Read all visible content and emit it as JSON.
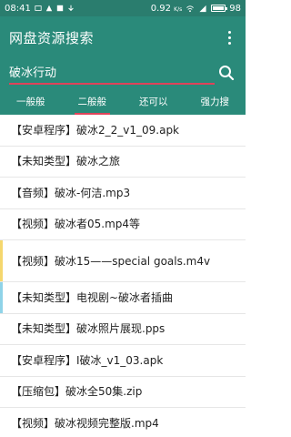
{
  "status_bar": {
    "time": "08:41",
    "left_icons": [
      "message-icon",
      "warning-icon",
      "flag-icon",
      "download-icon"
    ],
    "speed": "0.92",
    "speed_unit": "K/s",
    "battery_level": 98,
    "battery_text": "98"
  },
  "app_bar": {
    "title": "网盘资源搜索",
    "menu_icon": "more-vert-icon"
  },
  "search": {
    "value": "破冰行动",
    "icon": "search-icon"
  },
  "tabs": [
    {
      "label": "一般般",
      "active": false
    },
    {
      "label": "二般般",
      "active": true
    },
    {
      "label": "还可以",
      "active": false
    },
    {
      "label": "强力搜",
      "active": false
    }
  ],
  "results": [
    {
      "text": "【安卓程序】破冰2_2_v1_09.apk",
      "marker": ""
    },
    {
      "text": "【未知类型】破冰之旅",
      "marker": ""
    },
    {
      "text": "【音频】破冰-何洁.mp3",
      "marker": ""
    },
    {
      "text": "【视频】破冰者05.mp4等",
      "marker": ""
    },
    {
      "text": "【视频】破冰15——special goals.m4v",
      "marker": "#f5d76e"
    },
    {
      "text": "【未知类型】电视剧~破冰者插曲",
      "marker": "#8fd3e8"
    },
    {
      "text": "【未知类型】破冰照片展现.pps",
      "marker": ""
    },
    {
      "text": "【安卓程序】I破冰_v1_03.apk",
      "marker": ""
    },
    {
      "text": "【压缩包】破冰全50集.zip",
      "marker": ""
    },
    {
      "text": "【视频】破冰视频完整版.mp4",
      "marker": ""
    }
  ]
}
